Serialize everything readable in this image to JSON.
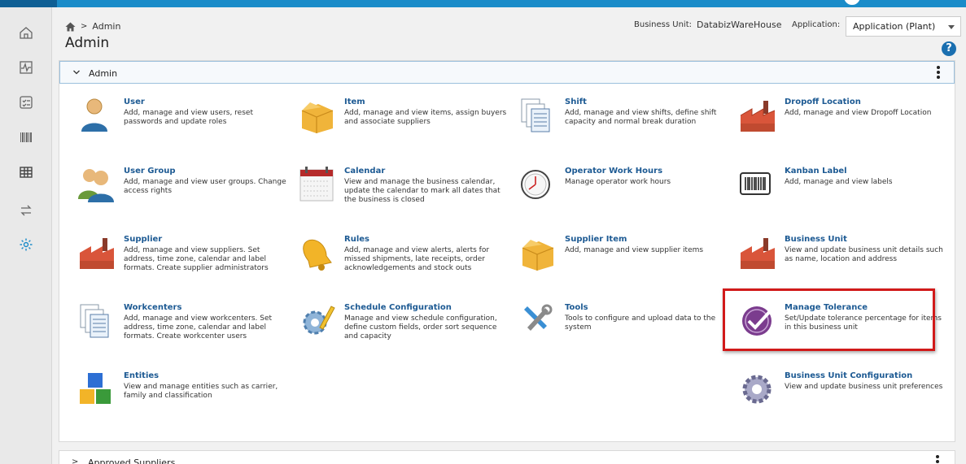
{
  "breadcrumb": {
    "current": "Admin"
  },
  "page": {
    "title": "Admin"
  },
  "header": {
    "business_unit_label": "Business Unit:",
    "business_unit_value": "DatabizWareHouse",
    "application_label": "Application:",
    "application_value": "Application (Plant)"
  },
  "sidebar": {
    "items": [
      {
        "icon": "home-icon"
      },
      {
        "icon": "activity-icon"
      },
      {
        "icon": "checklist-icon"
      },
      {
        "icon": "barcode-icon"
      },
      {
        "icon": "table-icon"
      },
      {
        "icon": "transfer-icon"
      },
      {
        "icon": "settings-icon"
      }
    ]
  },
  "admin_panel": {
    "title": "Admin",
    "tiles": [
      {
        "title": "User",
        "desc": "Add, manage and view users, reset passwords and update roles",
        "icon": "user-icon"
      },
      {
        "title": "Item",
        "desc": "Add, manage and view items, assign buyers and associate suppliers",
        "icon": "box-icon"
      },
      {
        "title": "Shift",
        "desc": "Add, manage and view shifts, define shift capacity and normal break duration",
        "icon": "documents-icon"
      },
      {
        "title": "Dropoff Location",
        "desc": "Add, manage and view Dropoff Location",
        "icon": "factory-icon"
      },
      {
        "title": "User Group",
        "desc": "Add, manage and view user groups. Change access rights",
        "icon": "user-group-icon"
      },
      {
        "title": "Calendar",
        "desc": "View and manage the business calendar, update the calendar to mark all dates that the business is closed",
        "icon": "calendar-icon"
      },
      {
        "title": "Operator Work Hours",
        "desc": "Manage operator work hours",
        "icon": "clock-icon"
      },
      {
        "title": "Kanban Label",
        "desc": "Add, manage and view labels",
        "icon": "barcode-label-icon"
      },
      {
        "title": "Supplier",
        "desc": "Add, manage and view suppliers. Set address, time zone, calendar and label formats. Create supplier administrators",
        "icon": "factory-icon"
      },
      {
        "title": "Rules",
        "desc": "Add, manage and view alerts, alerts for missed shipments, late receipts, order acknowledgements and stock outs",
        "icon": "bell-icon"
      },
      {
        "title": "Supplier Item",
        "desc": "Add, manage and view supplier items",
        "icon": "box-icon"
      },
      {
        "title": "Business Unit",
        "desc": "View and update business unit details such as name, location and address",
        "icon": "factory-icon"
      },
      {
        "title": "Workcenters",
        "desc": "Add, manage and view workcenters. Set address, time zone, calendar and label formats. Create workcenter users",
        "icon": "documents-icon"
      },
      {
        "title": "Schedule Configuration",
        "desc": "Manage and view schedule configuration, define custom fields, order sort sequence and capacity",
        "icon": "gear-pencil-icon"
      },
      {
        "title": "Tools",
        "desc": "Tools to configure and upload data to the system",
        "icon": "tools-icon"
      },
      {
        "title": "Manage Tolerance",
        "desc": "Set/Update tolerance percentage for items in this business unit",
        "icon": "checkmark-icon"
      },
      {
        "title": "Entities",
        "desc": "View and manage entities such as carrier, family and classification",
        "icon": "blocks-icon"
      },
      {
        "title": "Business Unit Configuration",
        "desc": "View and update business unit preferences",
        "icon": "gear-icon"
      }
    ]
  },
  "second_panel": {
    "title": "Approved Suppliers"
  }
}
